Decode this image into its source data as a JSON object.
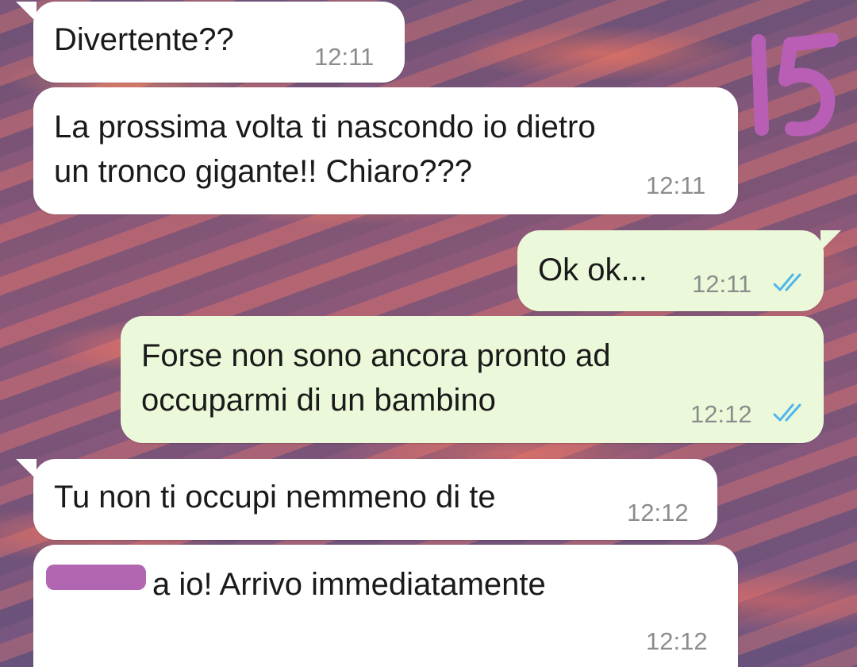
{
  "sticker": {
    "text": "15",
    "color": "#b85fb5"
  },
  "messages": [
    {
      "id": "m1",
      "direction": "incoming",
      "text": "Divertente??",
      "time": "12:11"
    },
    {
      "id": "m2",
      "direction": "incoming",
      "text": "La prossima volta ti nascondo io dietro\nun tronco gigante!! Chiaro???",
      "time": "12:11"
    },
    {
      "id": "m3",
      "direction": "outgoing",
      "text": "Ok ok...",
      "time": "12:11",
      "status": "read"
    },
    {
      "id": "m4",
      "direction": "outgoing",
      "text": "Forse non sono ancora pronto ad\noccuparmi di un bambino",
      "time": "12:12",
      "status": "read"
    },
    {
      "id": "m5",
      "direction": "incoming",
      "text": "Tu non ti occupi nemmeno di te",
      "time": "12:12"
    },
    {
      "id": "m6",
      "direction": "incoming",
      "text": "a io! Arrivo immediatamente",
      "time": "12:12",
      "redacted_prefix": true
    }
  ],
  "colors": {
    "incoming_bubble": "#ffffff",
    "outgoing_bubble": "#ebf9da",
    "read_ticks": "#4fb6ec",
    "redaction": "#b266b2"
  }
}
